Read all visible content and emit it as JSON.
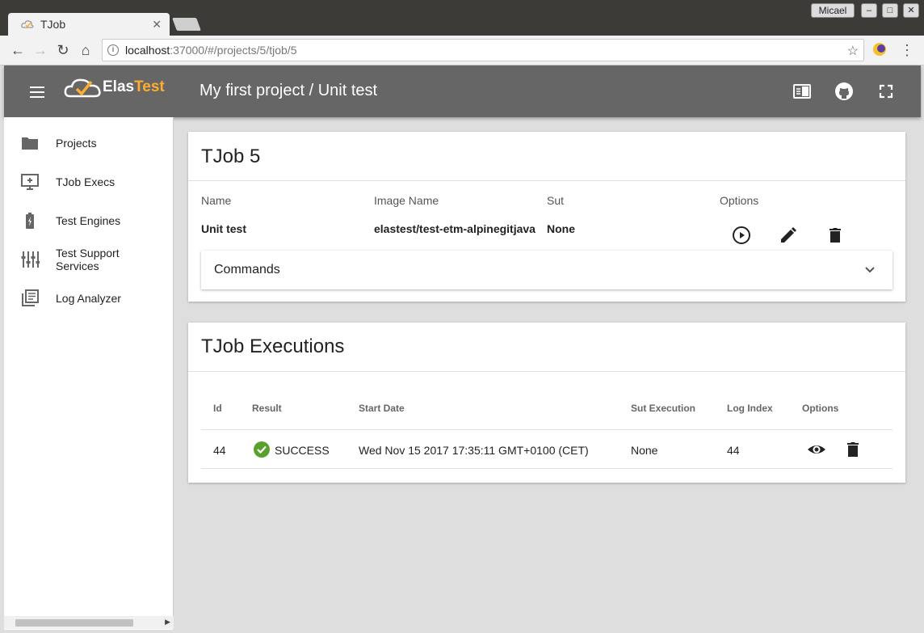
{
  "browser": {
    "tab_title": "TJob",
    "user": "Micael",
    "url_host": "localhost",
    "url_path": ":37000/#/projects/5/tjob/5"
  },
  "header": {
    "brand_part1": "Elas",
    "brand_part2": "Test",
    "title": "My first project / Unit test",
    "colors": {
      "bar": "#666666",
      "accent": "#ffac2f"
    }
  },
  "sidebar": {
    "items": [
      {
        "label": "Projects",
        "icon": "folder-icon"
      },
      {
        "label": "TJob Execs",
        "icon": "monitor-add-icon"
      },
      {
        "label": "Test Engines",
        "icon": "battery-icon"
      },
      {
        "label": "Test Support Services",
        "icon": "tune-icon"
      },
      {
        "label": "Log Analyzer",
        "icon": "library-books-icon"
      }
    ]
  },
  "tjob": {
    "title": "TJob 5",
    "headers": {
      "name": "Name",
      "image": "Image Name",
      "sut": "Sut",
      "options": "Options"
    },
    "values": {
      "name": "Unit test",
      "image": "elastest/test-etm-alpinegitjava",
      "sut": "None"
    },
    "commands_label": "Commands"
  },
  "executions": {
    "title": "TJob Executions",
    "columns": [
      "Id",
      "Result",
      "Start Date",
      "Sut Execution",
      "Log Index",
      "Options"
    ],
    "rows": [
      {
        "id": "44",
        "result": "SUCCESS",
        "start_date": "Wed Nov 15 2017 17:35:11 GMT+0100 (CET)",
        "sut_execution": "None",
        "log_index": "44"
      }
    ],
    "success_color": "#5aa02c"
  }
}
